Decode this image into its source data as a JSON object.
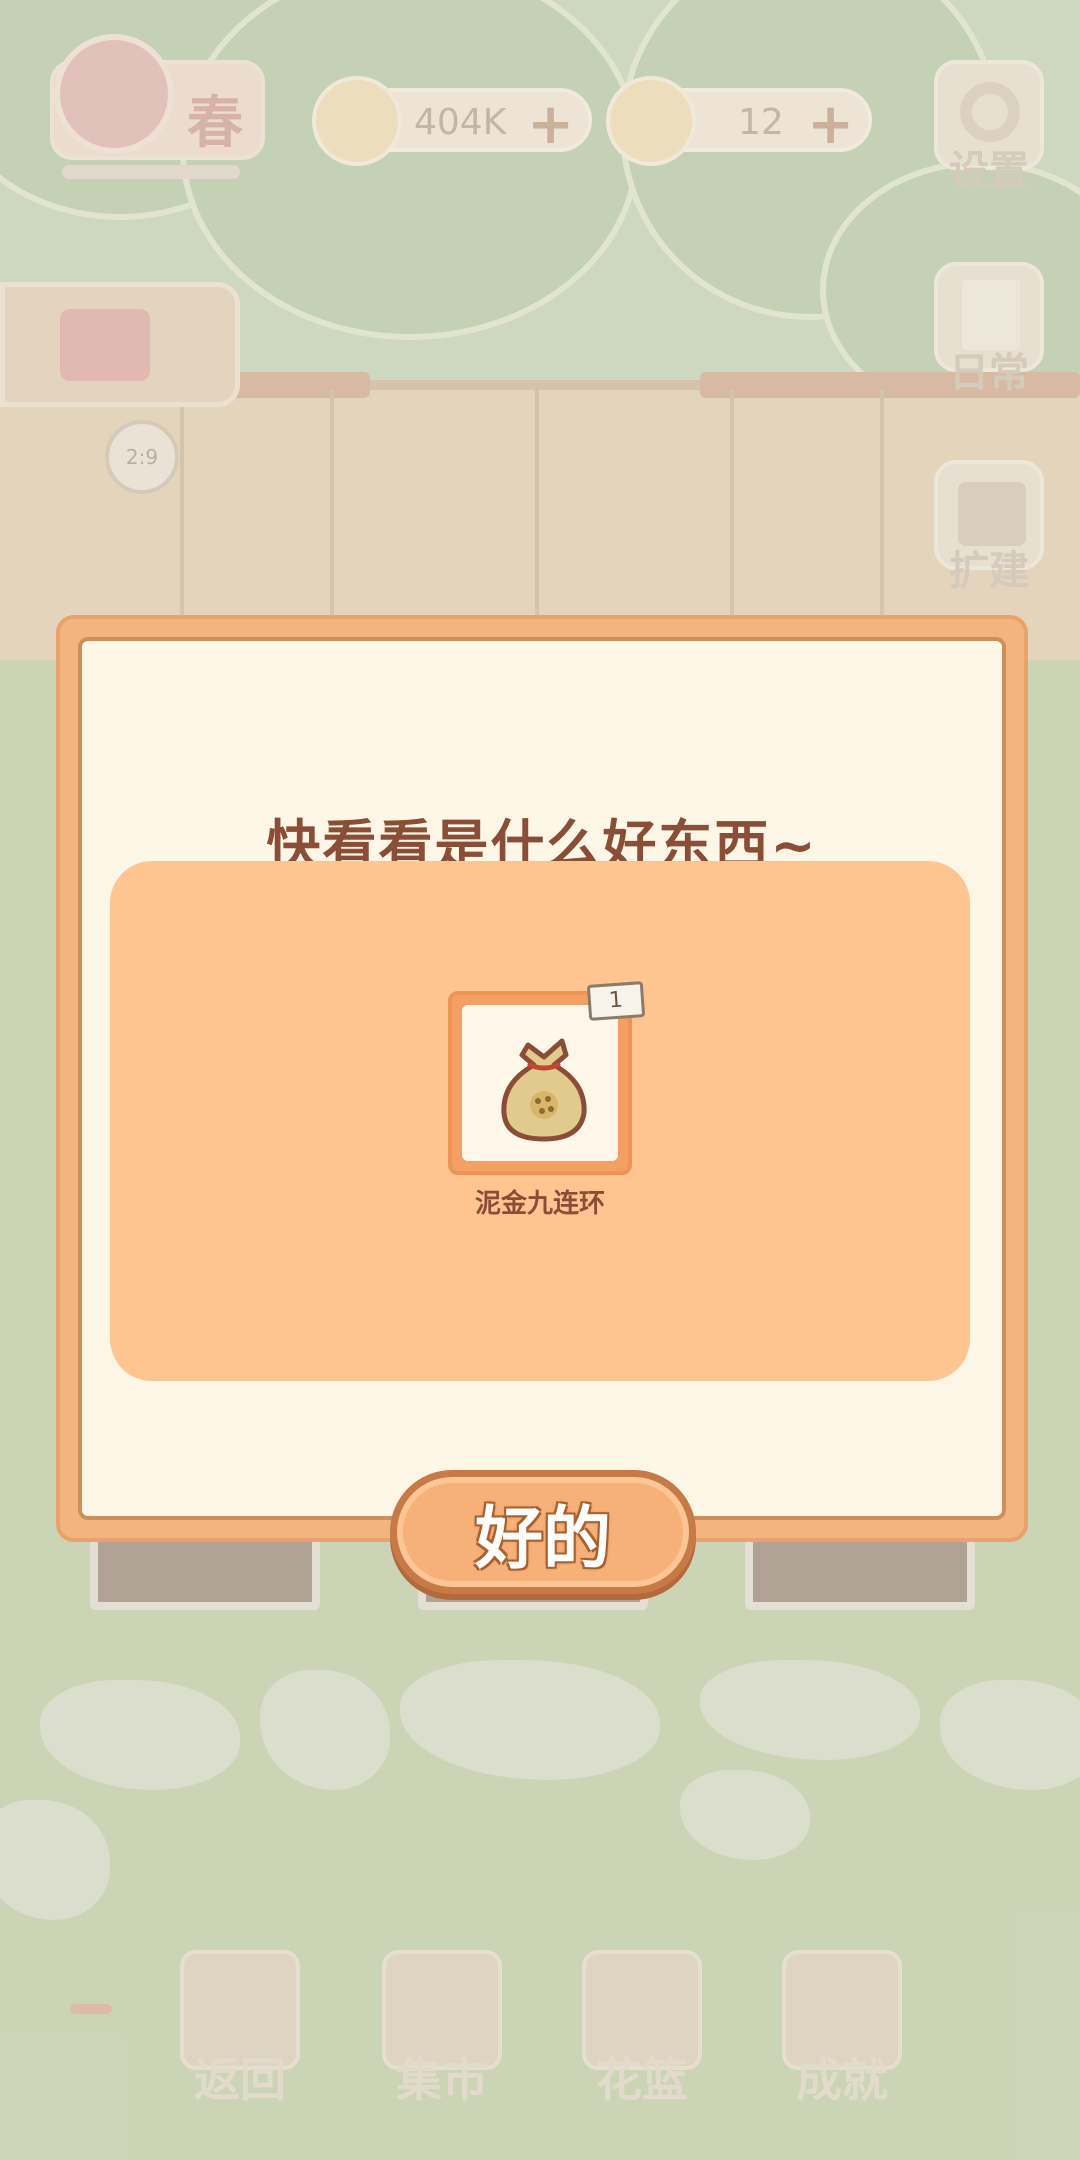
{
  "hud": {
    "season": "春",
    "fish_value": "404K",
    "cheese_value": "12",
    "plus_symbol": "+",
    "clock_time": "2:9",
    "side_buttons": [
      {
        "label": "设置",
        "icon": "gear-icon"
      },
      {
        "label": "日常",
        "icon": "tips-paper-icon"
      },
      {
        "label": "扩建",
        "icon": "hammer-paint-icon"
      }
    ]
  },
  "bottom_nav": [
    {
      "label": "返回",
      "icon": "window-door-icon"
    },
    {
      "label": "集市",
      "icon": "market-stall-icon"
    },
    {
      "label": "花篮",
      "icon": "flower-basket-icon"
    },
    {
      "label": "成就",
      "icon": "trophy-icon"
    }
  ],
  "dialog": {
    "title": "快看看是什么好东西~",
    "reward": {
      "name": "泥金九连环",
      "quantity": "1",
      "icon": "seed-sack-icon"
    },
    "confirm_label": "好的"
  },
  "colors": {
    "dialog_border": "#f4b47e",
    "reward_panel": "#ffc590",
    "title_text": "#8a4e36",
    "button_fill": "#f6b17a"
  }
}
